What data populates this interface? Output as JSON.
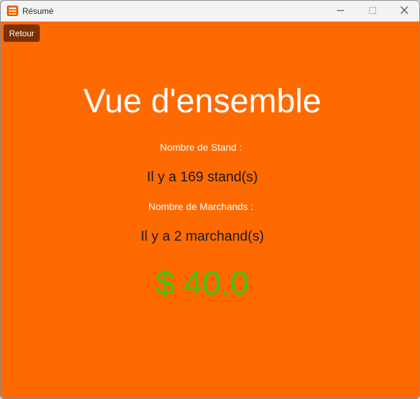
{
  "window": {
    "title": "Résumé",
    "icon": "app-icon"
  },
  "titlebar_buttons": {
    "minimize_icon": "minimize-icon",
    "maximize_icon": "maximize-icon",
    "close_icon": "close-icon"
  },
  "toolbar": {
    "back_label": "Retour"
  },
  "main": {
    "heading": "Vue d'ensemble",
    "stands_label": "Nombre de Stand :",
    "stands_value": "Il y a 169 stand(s)",
    "merchants_label": "Nombre de Marchands :",
    "merchants_value": "Il y a 2 marchand(s)",
    "total_amount": "$ 40.0"
  },
  "colors": {
    "background": "#ff6a00",
    "back_button": "#7a3200",
    "amount": "#3fc515",
    "titlebar": "#f3f3f3"
  }
}
